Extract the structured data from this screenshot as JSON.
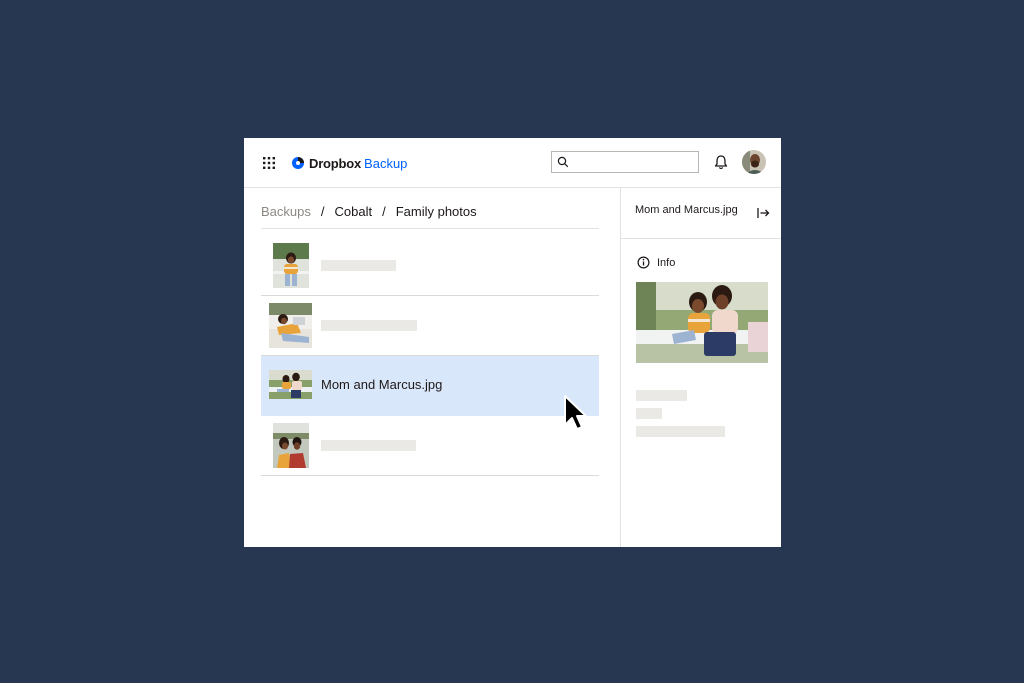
{
  "app": {
    "brand": "Dropbox",
    "product": "Backup",
    "brand_color": "#0061fe",
    "background_color": "#283751",
    "selected_row_color": "#d9e7fb"
  },
  "header": {
    "apps_icon": "grid-icon",
    "search": {
      "icon": "search-icon",
      "value": "",
      "placeholder": ""
    },
    "notifications_icon": "bell-icon",
    "avatar": "user-avatar"
  },
  "breadcrumb": {
    "items": [
      "Backups",
      "Cobalt",
      "Family photos"
    ],
    "separator": "/"
  },
  "files": [
    {
      "name": "",
      "thumbnail": "photo-girl-on-porch",
      "selected": false
    },
    {
      "name": "",
      "thumbnail": "photo-girl-reclining",
      "selected": false
    },
    {
      "name": "Mom and Marcus.jpg",
      "thumbnail": "photo-mom-and-marcus",
      "selected": true
    },
    {
      "name": "",
      "thumbnail": "photo-family-selfie",
      "selected": false
    }
  ],
  "details_panel": {
    "title": "Mom and Marcus.jpg",
    "close_icon": "collapse-panel-icon",
    "info_label": "Info",
    "info_icon": "info-icon"
  }
}
